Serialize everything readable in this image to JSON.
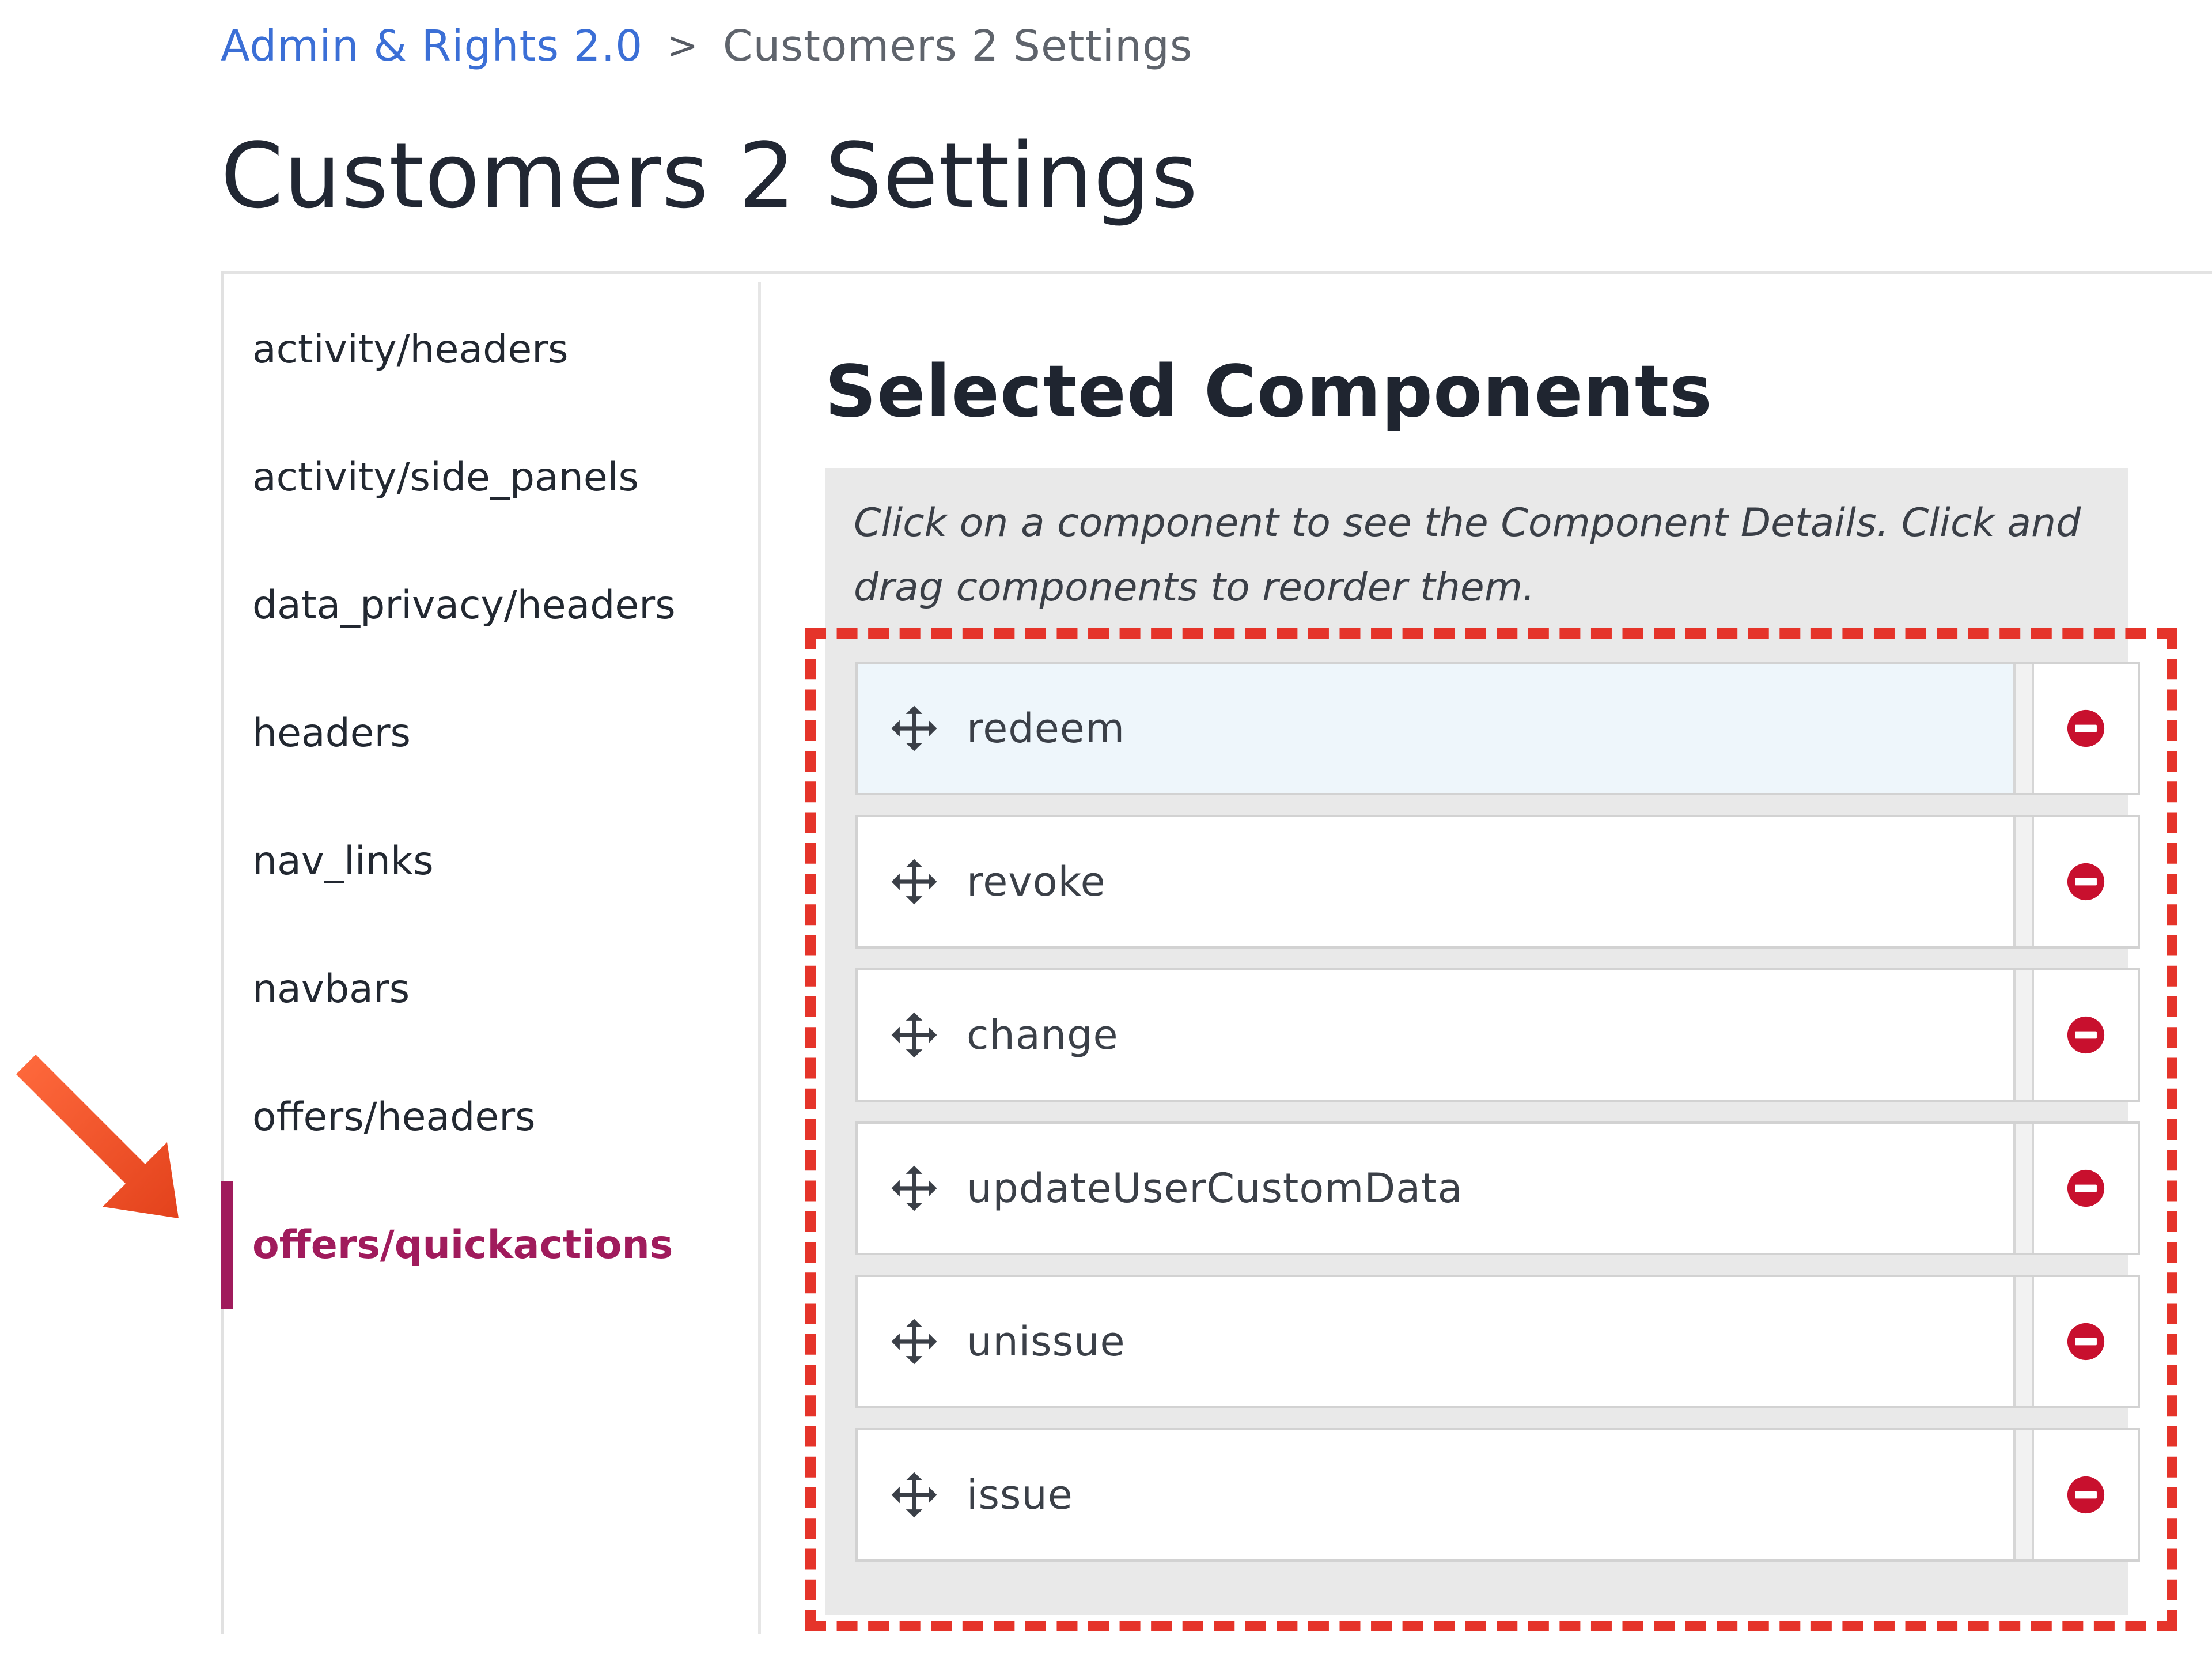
{
  "breadcrumb": {
    "parent": "Admin & Rights 2.0",
    "separator": ">",
    "current": "Customers 2 Settings"
  },
  "page_title": "Customers 2 Settings",
  "sidebar": {
    "active_color": "#a01b5c",
    "items": [
      {
        "label": "activity/headers",
        "active": false
      },
      {
        "label": "activity/side_panels",
        "active": false
      },
      {
        "label": "data_privacy/headers",
        "active": false
      },
      {
        "label": "headers",
        "active": false
      },
      {
        "label": "nav_links",
        "active": false
      },
      {
        "label": "navbars",
        "active": false
      },
      {
        "label": "offers/headers",
        "active": false
      },
      {
        "label": "offers/quickactions",
        "active": true
      }
    ]
  },
  "selected_components": {
    "title": "Selected Components",
    "help_text": "Click on a component to see the Component Details. Click and drag components to reorder them.",
    "items": [
      {
        "name": "redeem",
        "selected": true,
        "icon": "move-icon",
        "action_icon": "remove-icon"
      },
      {
        "name": "revoke",
        "selected": false,
        "icon": "move-icon",
        "action_icon": "remove-icon"
      },
      {
        "name": "change",
        "selected": false,
        "icon": "move-icon",
        "action_icon": "remove-icon"
      },
      {
        "name": "updateUserCustomData",
        "selected": false,
        "icon": "move-icon",
        "action_icon": "remove-icon"
      },
      {
        "name": "unissue",
        "selected": false,
        "icon": "move-icon",
        "action_icon": "remove-icon"
      },
      {
        "name": "issue",
        "selected": false,
        "icon": "move-icon",
        "action_icon": "remove-icon"
      }
    ]
  },
  "colors": {
    "link": "#3b6fd6",
    "highlight_annotation": "#e5342a",
    "remove": "#c8102e"
  }
}
